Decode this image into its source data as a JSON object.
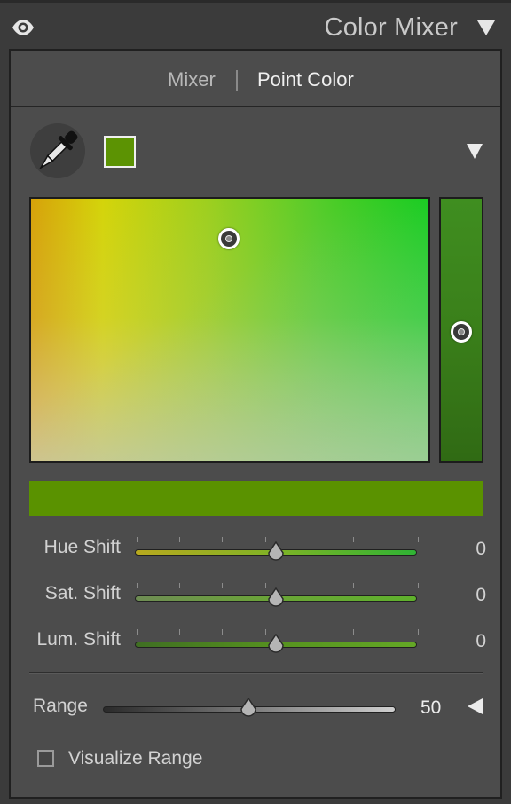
{
  "header": {
    "title": "Color Mixer",
    "eye_icon": "eye-icon",
    "collapse_icon": "triangle-down-icon"
  },
  "tabs": [
    {
      "label": "Mixer",
      "active": false
    },
    {
      "label": "Point Color",
      "active": true
    }
  ],
  "point_color": {
    "picker_icon": "eyedropper-icon",
    "swatch_color": "#5c9303",
    "menu_icon": "triangle-down-icon",
    "selected_color_bar": "#5a9200"
  },
  "sliders": [
    {
      "label": "Hue Shift",
      "value": "0",
      "position": 0.5
    },
    {
      "label": "Sat. Shift",
      "value": "0",
      "position": 0.5
    },
    {
      "label": "Lum. Shift",
      "value": "0",
      "position": 0.5
    }
  ],
  "range": {
    "label": "Range",
    "value": "50",
    "position": 0.5,
    "collapse_icon": "triangle-left-icon"
  },
  "visualize": {
    "label": "Visualize Range",
    "checked": false
  },
  "colors": {
    "panel_bg": "#4c4c4c",
    "accent_green": "#5a9200"
  }
}
